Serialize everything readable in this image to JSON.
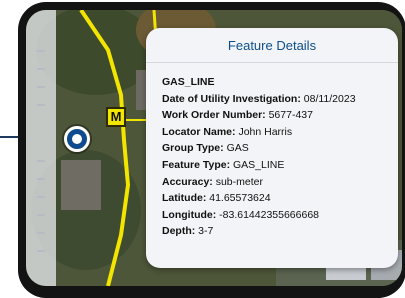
{
  "popup": {
    "title": "Feature Details",
    "heading": "GAS_LINE",
    "fields": [
      {
        "label": "Date of Utility Investigation:",
        "value": "08/11/2023"
      },
      {
        "label": "Work Order Number:",
        "value": "5677-437"
      },
      {
        "label": "Locator Name:",
        "value": "John Harris"
      },
      {
        "label": "Group Type:",
        "value": "GAS"
      },
      {
        "label": "Feature Type:",
        "value": "GAS_LINE"
      },
      {
        "label": "Accuracy:",
        "value": "sub-meter"
      },
      {
        "label": "Latitude:",
        "value": "41.65573624"
      },
      {
        "label": "Longitude:",
        "value": "-83.61442355666668"
      },
      {
        "label": "Depth:",
        "value": "3-7"
      }
    ]
  },
  "map": {
    "marker_letter": "M",
    "gas_line_color": "#f2e600",
    "locate_button_color": "#0e4a8e"
  }
}
